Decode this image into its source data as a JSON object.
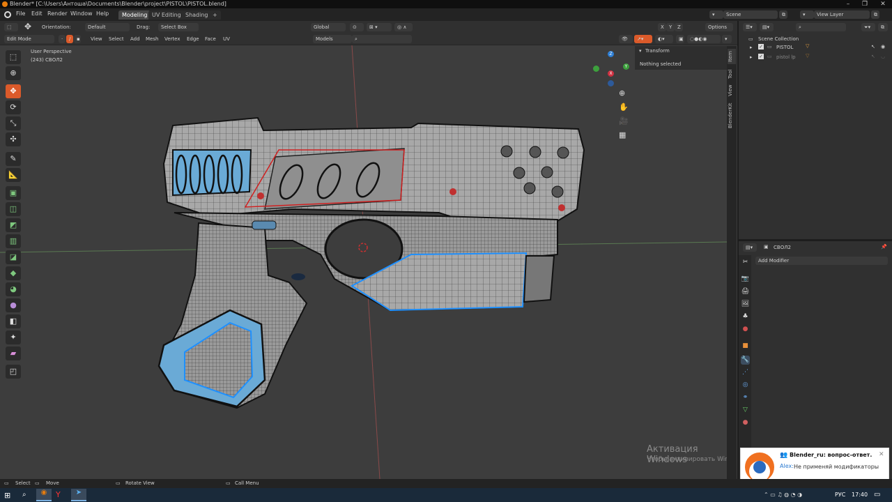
{
  "window": {
    "title": "Blender* [C:\\Users\\Антоша\\Documents\\Blender\\project\\PISTOL\\PISTOL.blend]"
  },
  "menu": {
    "file": "File",
    "edit": "Edit",
    "render": "Render",
    "window": "Window",
    "help": "Help"
  },
  "workspaces": {
    "modeling": "Modeling",
    "uv_editing": "UV Editing",
    "shading": "Shading",
    "add": "+"
  },
  "scene": {
    "name": "Scene",
    "view_layer": "View Layer"
  },
  "toolheader": {
    "orientation_label": "Orientation:",
    "orientation_value": "Default",
    "drag_label": "Drag:",
    "drag_value": "Select Box",
    "transform_orient": "Global",
    "axis_x": "X",
    "axis_y": "Y",
    "axis_z": "Z",
    "options": "Options"
  },
  "editheader": {
    "mode": "Edit Mode",
    "view": "View",
    "select": "Select",
    "add": "Add",
    "mesh": "Mesh",
    "vertex": "Vertex",
    "edge": "Edge",
    "face": "Face",
    "uv": "UV",
    "collection": "Models"
  },
  "viewport": {
    "perspective": "User Perspective",
    "object_info": "(243) СВОЛ2",
    "watermark_title": "Активация Windows",
    "watermark_sub": "Чтобы активировать Windows, перейдите в раздел \"Параметры\"."
  },
  "npanel": {
    "header": "Transform",
    "body": "Nothing selected",
    "tabs": [
      "Item",
      "Tool",
      "View",
      "BlenderKit"
    ]
  },
  "outliner": {
    "root": "Scene Collection",
    "items": [
      {
        "name": "PISTOL"
      },
      {
        "name": "pistol lp"
      }
    ]
  },
  "properties": {
    "object": "СВОЛ2",
    "add_modifier": "Add Modifier"
  },
  "status": {
    "select": "Select",
    "move": "Move",
    "rotate": "Rotate View",
    "call_menu": "Call Menu"
  },
  "taskbar": {
    "lang": "РУС",
    "time": "17:40"
  },
  "notification": {
    "title": "Blender_ru: вопрос-ответ.",
    "sender": "Alex:",
    "message": "Не применяй модификаторы"
  },
  "colors": {
    "accent": "#db5a2a",
    "selected_edge": "#1e90ff",
    "header": "#303030",
    "viewport": "#3d3d3d"
  }
}
